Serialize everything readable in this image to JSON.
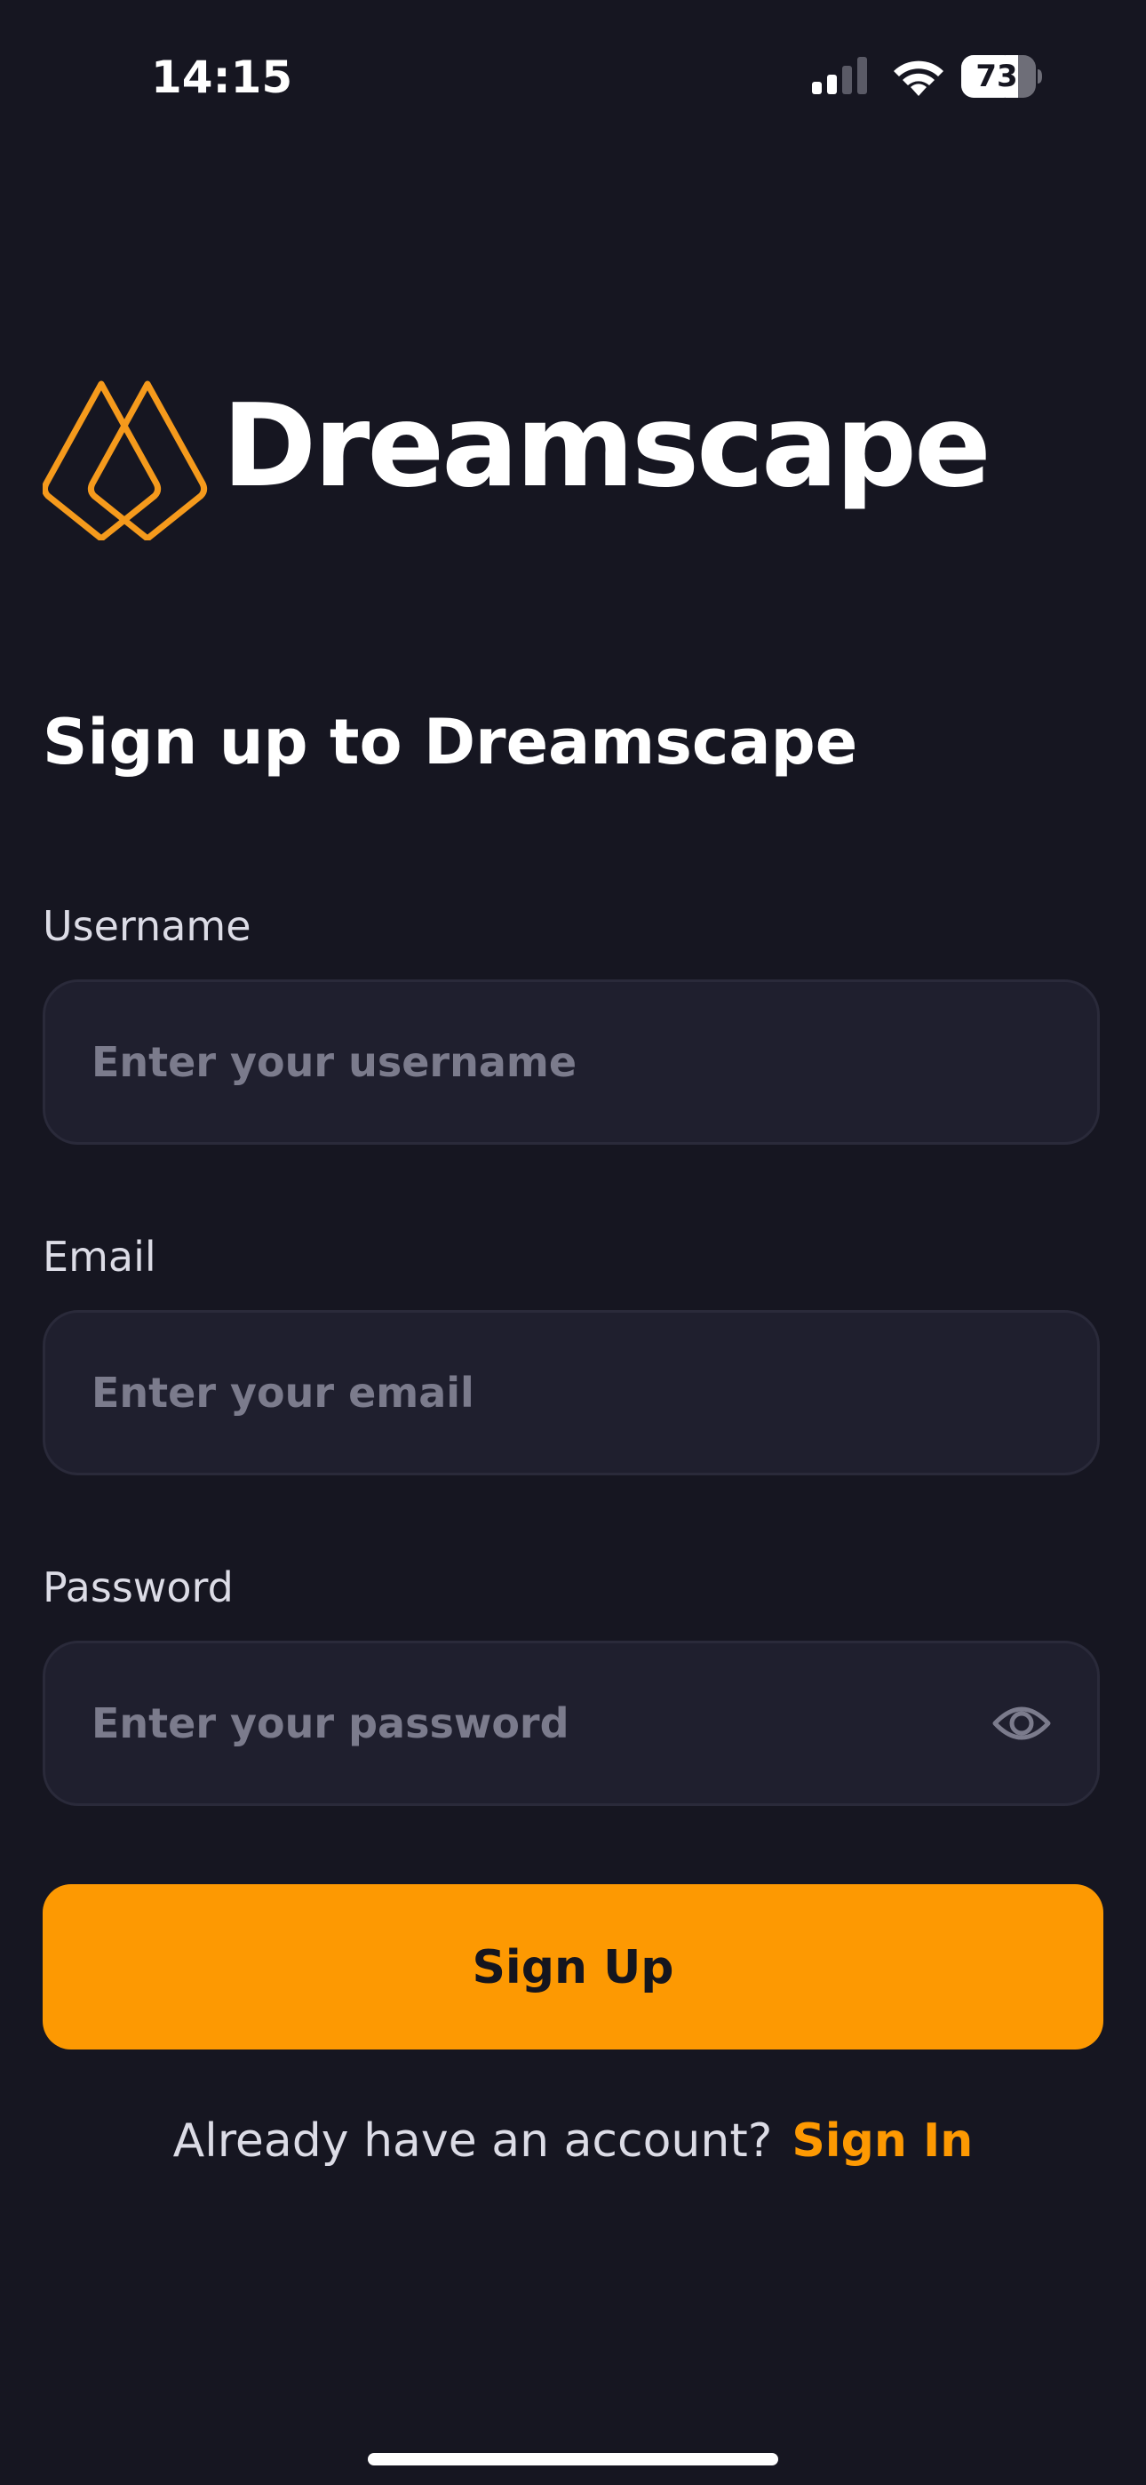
{
  "status_bar": {
    "time": "14:15",
    "battery_level": "73",
    "icons": [
      "signal-icon",
      "wifi-icon",
      "battery-icon"
    ]
  },
  "brand": {
    "name": "Dreamscape",
    "logo_icon": "dreamscape-logo-icon",
    "accent_color": "#fd9902",
    "background_color": "#161621"
  },
  "form": {
    "title": "Sign up to Dreamscape",
    "username": {
      "label": "Username",
      "placeholder": "Enter your username",
      "value": ""
    },
    "email": {
      "label": "Email",
      "placeholder": "Enter your email",
      "value": ""
    },
    "password": {
      "label": "Password",
      "placeholder": "Enter your password",
      "value": "",
      "toggle_icon": "eye-icon"
    },
    "submit_label": "Sign Up"
  },
  "footer": {
    "prompt": "Already have an account?",
    "link_label": "Sign In"
  }
}
